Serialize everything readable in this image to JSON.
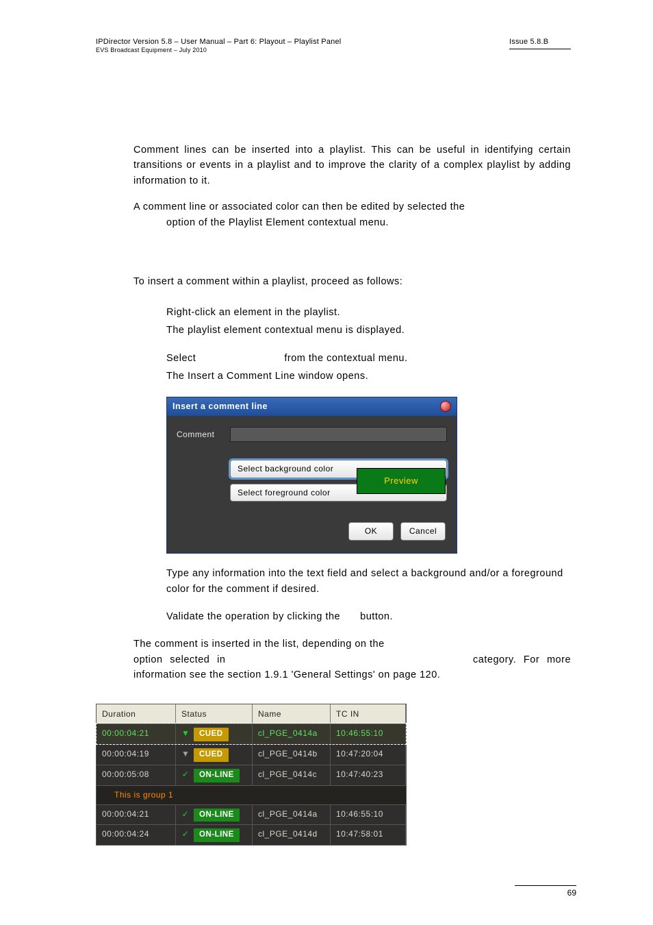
{
  "header": {
    "left_line1": "IPDirector Version 5.8 – User Manual – Part 6: Playout – Playlist Panel",
    "left_line2": "EVS Broadcast Equipment – July 2010",
    "right": "Issue 5.8.B"
  },
  "intro": {
    "p1": "Comment lines can be inserted into a playlist. This can be useful in identifying certain transitions or events in a playlist and to improve the clarity of a complex playlist by adding information to it.",
    "p2a": "A comment line or associated color can then be edited by selected the",
    "p2b": "option of the Playlist Element contextual menu."
  },
  "howto": {
    "lead": "To insert a comment within a playlist, proceed as follows:",
    "step1a": "Right-click an element in the playlist.",
    "step1b": "The playlist element contextual menu is displayed.",
    "step2a_pre": "Select",
    "step2a_post": "from the contextual menu.",
    "step2b": "The Insert a Comment Line window opens.",
    "step3": "Type any information into the text field and select a background and/or a foreground color for the comment if desired.",
    "step4_pre": "Validate the operation by clicking the",
    "step4_post": "button."
  },
  "dialog": {
    "title": "Insert a comment line",
    "label_comment": "Comment",
    "btn_bg": "Select background color",
    "btn_fg": "Select foreground color",
    "preview": "Preview",
    "btn_ok": "OK",
    "btn_cancel": "Cancel"
  },
  "after": {
    "p1_pre": "The comment is inserted in the list, depending on the",
    "p1_mid": "option selected in",
    "p1_post": "category. For more information see the section 1.9.1 'General Settings' on page 120."
  },
  "table": {
    "headers": {
      "duration": "Duration",
      "status": "Status",
      "name": "Name",
      "tcin": "TC IN"
    },
    "rows": [
      {
        "duration": "00:00:04:21",
        "status": "CUED",
        "status_type": "cued",
        "icon": "tri",
        "name": "cl_PGE_0414a",
        "tcin": "10:46:55:10",
        "selected": true
      },
      {
        "duration": "00:00:04:19",
        "status": "CUED",
        "status_type": "cued",
        "icon": "tri-gray",
        "name": "cl_PGE_0414b",
        "tcin": "10:47:20:04",
        "selected": false
      },
      {
        "duration": "00:00:05:08",
        "status": "ON-LINE",
        "status_type": "online",
        "icon": "check",
        "name": "cl_PGE_0414c",
        "tcin": "10:47:40:23",
        "selected": false
      }
    ],
    "group_label": "This is group 1",
    "rows2": [
      {
        "duration": "00:00:04:21",
        "status": "ON-LINE",
        "status_type": "online",
        "icon": "check",
        "name": "cl_PGE_0414a",
        "tcin": "10:46:55:10",
        "selected": false
      },
      {
        "duration": "00:00:04:24",
        "status": "ON-LINE",
        "status_type": "online",
        "icon": "check",
        "name": "cl_PGE_0414d",
        "tcin": "10:47:58:01",
        "selected": false
      }
    ]
  },
  "footer": {
    "page_number": "69"
  }
}
